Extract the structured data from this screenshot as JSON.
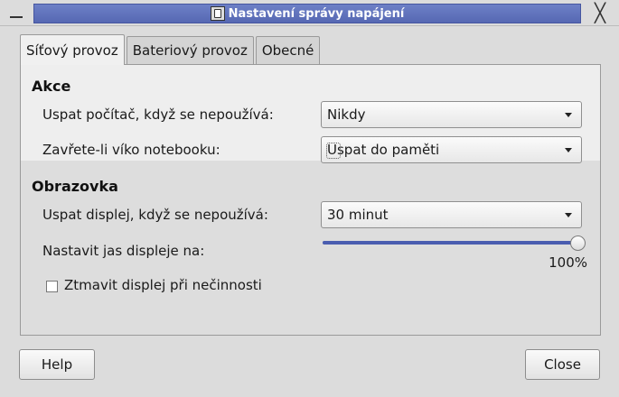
{
  "window": {
    "title": "Nastavení správy napájení",
    "icon": "power-manager-icon",
    "close_glyph": "╳"
  },
  "tabs": [
    {
      "label": "Síťový provoz",
      "active": true
    },
    {
      "label": "Bateriový provoz",
      "active": false
    },
    {
      "label": "Obecné",
      "active": false
    }
  ],
  "actions": {
    "heading": "Akce",
    "sleep_computer": {
      "label": "Uspat počítač, když se nepoužívá:",
      "value": "Nikdy"
    },
    "lid_close": {
      "label": "Zavřete-li víko notebooku:",
      "value": "Uspat do paměti"
    }
  },
  "display": {
    "heading": "Obrazovka",
    "sleep_display": {
      "label": "Uspat displej, když se nepoužívá:",
      "value": "30 minut"
    },
    "brightness": {
      "label": "Nastavit jas displeje na:",
      "value": 100,
      "value_text": "100%"
    },
    "dim_display": {
      "label": "Ztmavit displej při nečinnosti",
      "checked": false
    }
  },
  "footer": {
    "help_label": "Help",
    "close_label": "Close"
  },
  "colors": {
    "titlebar_accent": "#5b6db8",
    "slider_fill": "#4a5db0"
  }
}
